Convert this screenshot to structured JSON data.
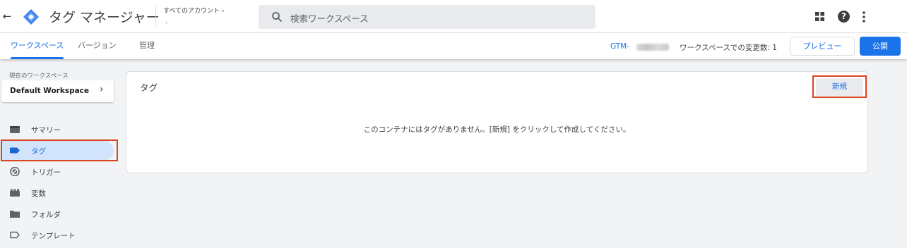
{
  "app": {
    "title": "タグ マネージャー",
    "accounts_label": "すべてのアカウント",
    "account_name": "・"
  },
  "search": {
    "placeholder": "検索ワークスペース"
  },
  "tabs": [
    {
      "label": "ワークスペース",
      "active": true
    },
    {
      "label": "バージョン",
      "active": false
    },
    {
      "label": "管理",
      "active": false
    }
  ],
  "header": {
    "container_id_prefix": "GTM-",
    "changes_label": "ワークスペースでの変更数: 1",
    "preview_label": "プレビュー",
    "publish_label": "公開"
  },
  "sidebar": {
    "current_workspace_label": "現在のワークスペース",
    "workspace_name": "Default Workspace",
    "items": [
      {
        "label": "サマリー",
        "icon": "summary-icon",
        "active": false
      },
      {
        "label": "タグ",
        "icon": "tag-icon",
        "active": true
      },
      {
        "label": "トリガー",
        "icon": "trigger-icon",
        "active": false
      },
      {
        "label": "変数",
        "icon": "variables-icon",
        "active": false
      },
      {
        "label": "フォルダ",
        "icon": "folder-icon",
        "active": false
      },
      {
        "label": "テンプレート",
        "icon": "template-icon",
        "active": false
      }
    ]
  },
  "main": {
    "card_title": "タグ",
    "new_button_label": "新規",
    "empty_message": "このコンテナにはタグがありません。[新規] をクリックして作成してください。"
  },
  "colors": {
    "accent": "#1a73e8",
    "highlight": "#d9431e",
    "active_nav_bg": "#d2e3fc"
  }
}
